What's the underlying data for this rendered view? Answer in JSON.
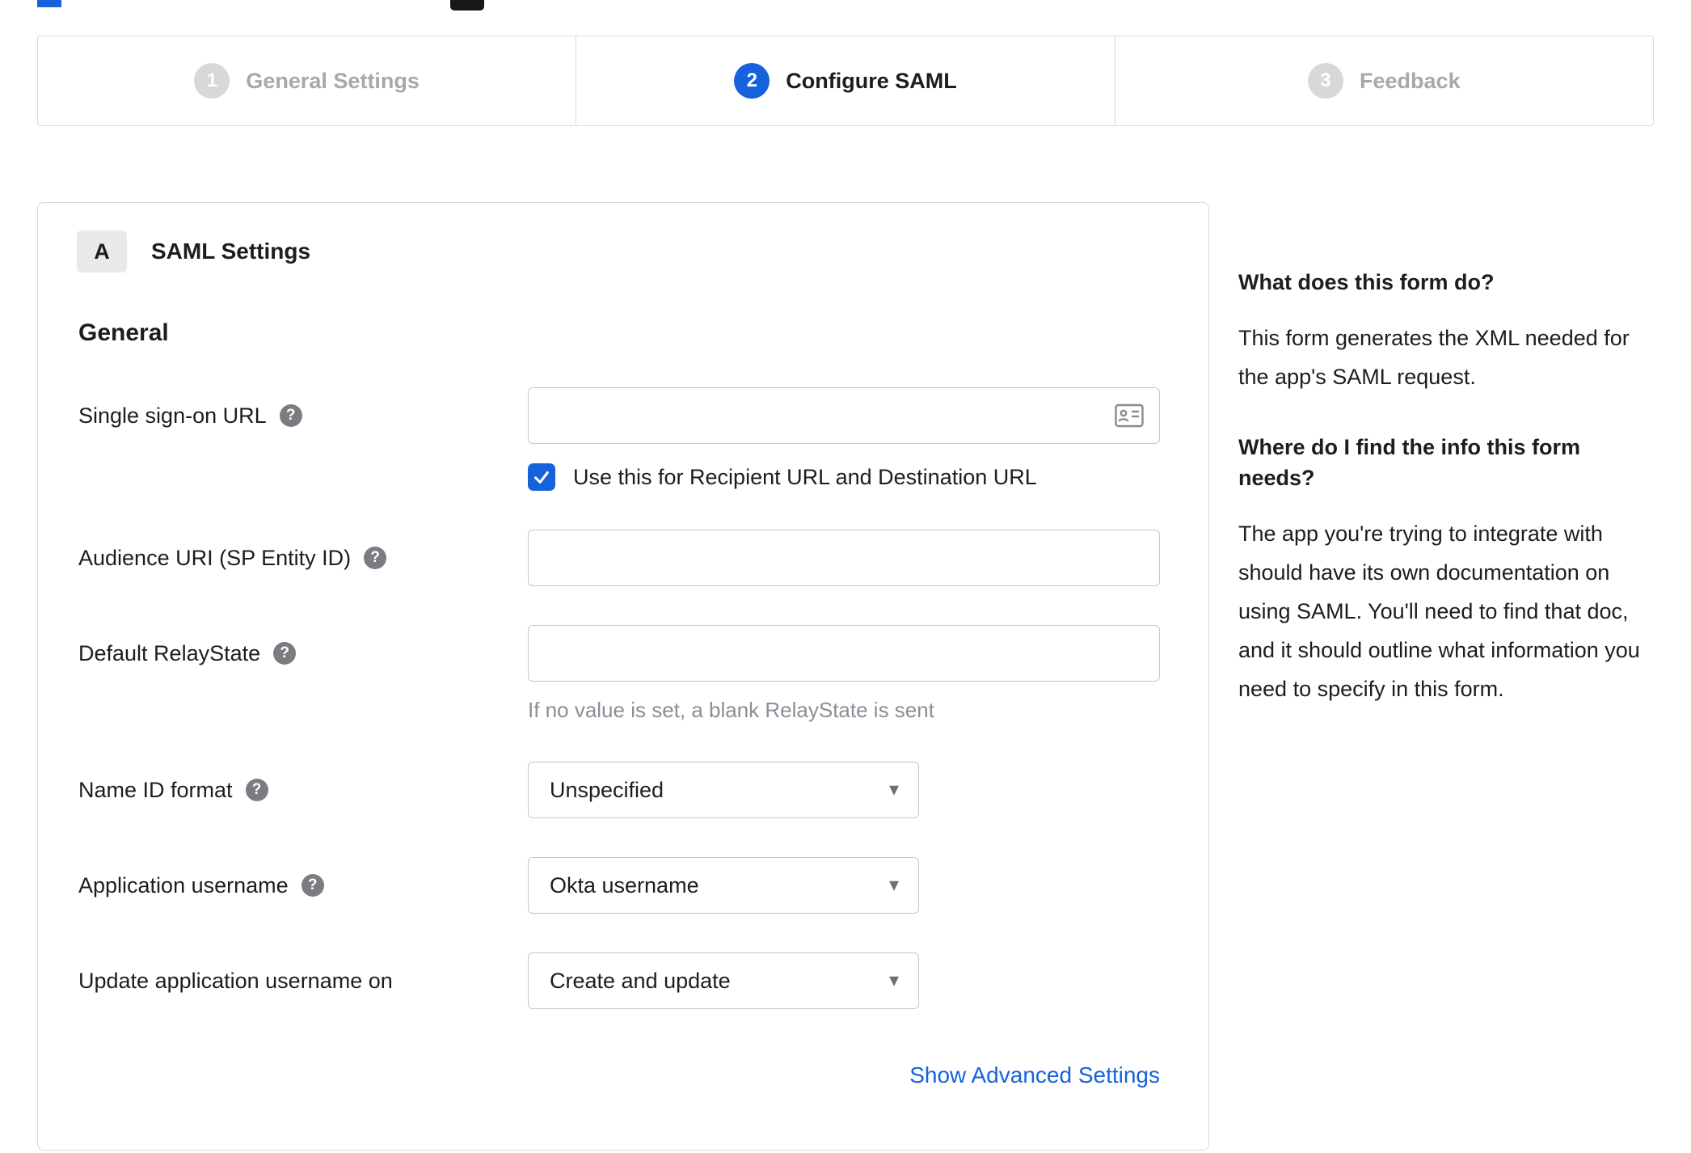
{
  "colors": {
    "accent": "#1662dd",
    "inactive_step": "#d8d8d8",
    "text_dark": "#1d1d21",
    "text_muted": "#8d8d96"
  },
  "icons": {
    "help_glyph": "?",
    "caret_glyph": "▾"
  },
  "stepper": {
    "steps": [
      {
        "number": "1",
        "label": "General Settings",
        "state": "inactive"
      },
      {
        "number": "2",
        "label": "Configure SAML",
        "state": "active"
      },
      {
        "number": "3",
        "label": "Feedback",
        "state": "inactive"
      }
    ]
  },
  "panel": {
    "section_badge": "A",
    "section_title": "SAML Settings",
    "group_title": "General",
    "fields": [
      {
        "label": "Single sign-on URL",
        "type": "text",
        "value": "",
        "placeholder": "",
        "has_help": true,
        "trailing_icon": "contact-card-icon",
        "checkbox": {
          "checked": true,
          "label": "Use this for Recipient URL and Destination URL"
        }
      },
      {
        "label": "Audience URI (SP Entity ID)",
        "type": "text",
        "value": "",
        "placeholder": "",
        "has_help": true
      },
      {
        "label": "Default RelayState",
        "type": "text",
        "value": "",
        "placeholder": "",
        "has_help": true,
        "hint": "If no value is set, a blank RelayState is sent"
      },
      {
        "label": "Name ID format",
        "type": "select",
        "value": "Unspecified",
        "has_help": true
      },
      {
        "label": "Application username",
        "type": "select",
        "value": "Okta username",
        "has_help": true
      },
      {
        "label": "Update application username on",
        "type": "select",
        "value": "Create and update",
        "has_help": false
      }
    ],
    "show_advanced_label": "Show Advanced Settings"
  },
  "sidebar": {
    "heading1": "What does this form do?",
    "para1": "This form generates the XML needed for the app's SAML request.",
    "heading2": "Where do I find the info this form needs?",
    "para2": "The app you're trying to integrate with should have its own documentation on using SAML. You'll need to find that doc, and it should outline what information you need to specify in this form."
  }
}
